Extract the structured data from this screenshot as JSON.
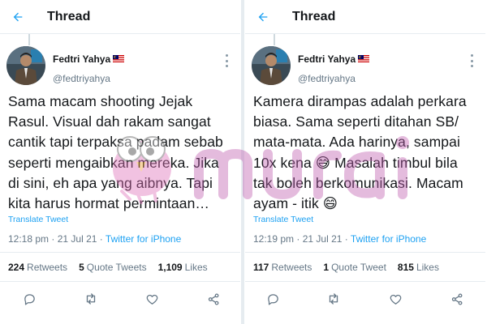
{
  "panels": [
    {
      "header": {
        "title": "Thread"
      },
      "author": {
        "display_name": "Fedtri Yahya",
        "handle": "@fedtriyahya",
        "flag": "malaysia-flag-icon"
      },
      "tweet_lines": [
        "Sama macam shooting Jejak",
        "Rasul. Visual dah rakam sangat",
        "cantik tapi terpaksa padam sebab",
        "seperti mengaibkan mereka. Jika",
        "di sini, eh apa yang aibnya. Tapi",
        "kita harus hormat permintaan…"
      ],
      "translate_label": "Translate Tweet",
      "time": "12:18 pm",
      "date": "21 Jul 21",
      "client": "Twitter for iPhone",
      "stats": {
        "retweets_count": "224",
        "retweets_label": "Retweets",
        "quotes_count": "5",
        "quotes_label": "Quote Tweets",
        "likes_count": "1,109",
        "likes_label": "Likes"
      }
    },
    {
      "header": {
        "title": "Thread"
      },
      "author": {
        "display_name": "Fedtri Yahya",
        "handle": "@fedtriyahya",
        "flag": "malaysia-flag-icon"
      },
      "tweet_lines": [
        "Kamera dirampas adalah perkara",
        "biasa. Sama seperti ditahan SB/",
        "mata-mata. Ada harinya, sampai",
        "10x kena 😅 Masalah timbul bila",
        "tak boleh berkomunikasi. Macam",
        "ayam - itik 😄"
      ],
      "translate_label": "Translate Tweet",
      "time": "12:19 pm",
      "date": "21 Jul 21",
      "client": "Twitter for iPhone",
      "stats": {
        "retweets_count": "117",
        "retweets_label": "Retweets",
        "quotes_count": "1",
        "quotes_label": "Quote Tweet",
        "likes_count": "815",
        "likes_label": "Likes"
      }
    }
  ],
  "meta_separator": "·",
  "colors": {
    "accent": "#1da1f2",
    "text": "#14171a",
    "muted": "#657786",
    "divider": "#e6ecf0"
  },
  "watermark": {
    "text": "murai",
    "mascot": "bird-mascot-icon"
  }
}
